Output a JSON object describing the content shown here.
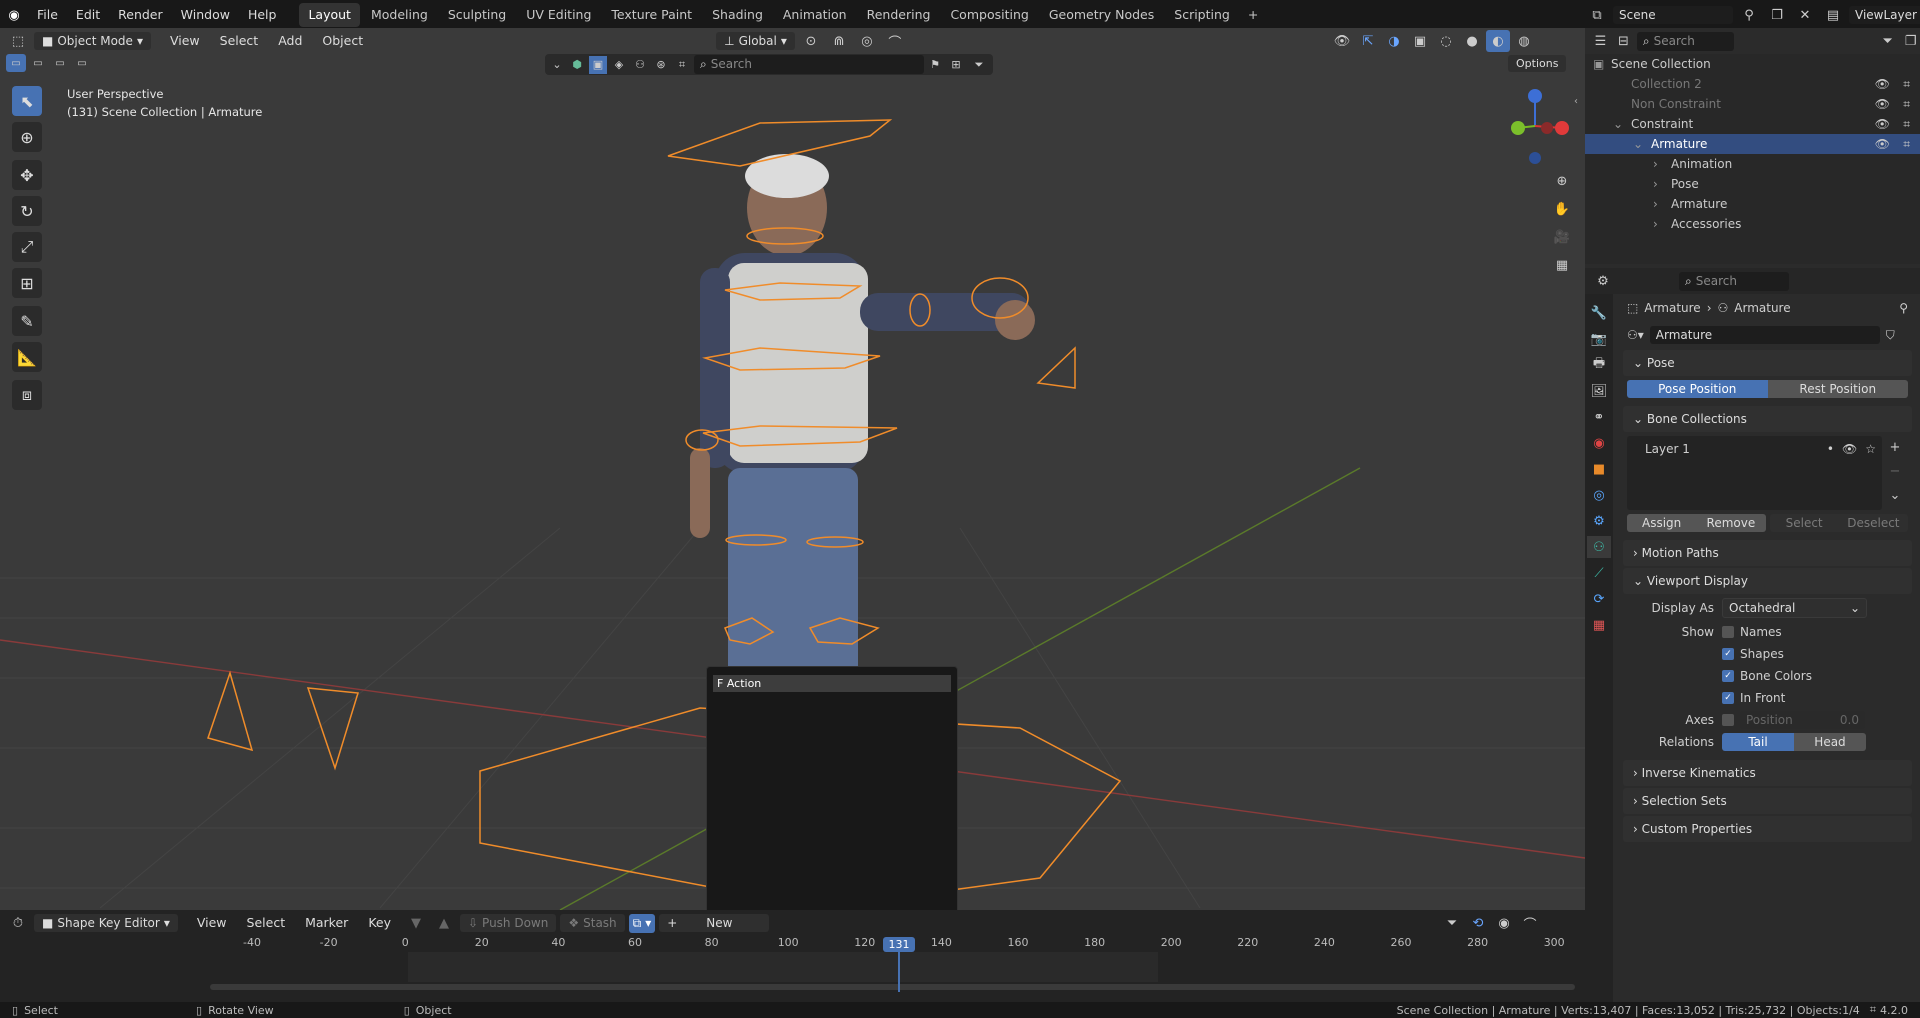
{
  "topbar": {
    "menu": [
      "File",
      "Edit",
      "Render",
      "Window",
      "Help"
    ],
    "workspaces": [
      "Layout",
      "Modeling",
      "Sculpting",
      "UV Editing",
      "Texture Paint",
      "Shading",
      "Animation",
      "Rendering",
      "Compositing",
      "Geometry Nodes",
      "Scripting"
    ],
    "active_workspace": "Layout",
    "add_tab": "+",
    "scene_label": "Scene",
    "viewlayer_label": "ViewLayer"
  },
  "viewport_header": {
    "mode": "Object Mode",
    "menus": [
      "View",
      "Select",
      "Add",
      "Object"
    ],
    "orientation": "Global",
    "options_label": "Options",
    "search_placeholder": "Search"
  },
  "viewport": {
    "perspective": "User Perspective",
    "collection_info": "(131) Scene Collection | Armature"
  },
  "action_popup": {
    "item": "F Action",
    "search_value": ""
  },
  "outliner": {
    "search_placeholder": "Search",
    "rows": [
      {
        "label": "Scene Collection",
        "indent": 0
      },
      {
        "label": "Collection 2",
        "indent": 1,
        "dim": true
      },
      {
        "label": "Non Constraint",
        "indent": 1,
        "dim": true
      },
      {
        "label": "Constraint",
        "indent": 1
      },
      {
        "label": "Armature",
        "indent": 2,
        "selected": true
      },
      {
        "label": "Animation",
        "indent": 3
      },
      {
        "label": "Pose",
        "indent": 3
      },
      {
        "label": "Armature",
        "indent": 3
      },
      {
        "label": "Accessories",
        "indent": 3
      }
    ]
  },
  "properties": {
    "search_placeholder": "Search",
    "breadcrumb": [
      "Armature",
      "Armature"
    ],
    "datablock_name": "Armature",
    "sections": {
      "pose": "Pose",
      "pose_position": "Pose Position",
      "rest_position": "Rest Position",
      "bone_collections": "Bone Collections",
      "layer": "Layer 1",
      "assign": "Assign",
      "remove": "Remove",
      "select": "Select",
      "deselect": "Deselect",
      "motion_paths": "Motion Paths",
      "viewport_display": "Viewport Display",
      "display_as_label": "Display As",
      "display_as_value": "Octahedral",
      "show_label": "Show",
      "names": "Names",
      "shapes": "Shapes",
      "bone_colors": "Bone Colors",
      "in_front": "In Front",
      "axes_label": "Axes",
      "axes_position": "Position",
      "axes_value": "0.0",
      "relations_label": "Relations",
      "tail": "Tail",
      "head": "Head",
      "inverse_kinematics": "Inverse Kinematics",
      "selection_sets": "Selection Sets",
      "custom_properties": "Custom Properties"
    }
  },
  "timeline": {
    "editor": "Shape Key Editor",
    "menus": [
      "View",
      "Select",
      "Marker",
      "Key"
    ],
    "push_down": "Push Down",
    "stash": "Stash",
    "new": "New",
    "ticks": [
      "-40",
      "-20",
      "0",
      "20",
      "40",
      "60",
      "80",
      "100",
      "120",
      "140",
      "160",
      "180",
      "200",
      "220",
      "240",
      "260",
      "280",
      "300"
    ],
    "current_frame": "131"
  },
  "statusbar": {
    "select": "Select",
    "rotate": "Rotate View",
    "object": "Object",
    "stats": "Scene Collection | Armature | Verts:13,407 | Faces:13,052 | Tris:25,732 | Objects:1/4",
    "version": "4.2.0"
  }
}
